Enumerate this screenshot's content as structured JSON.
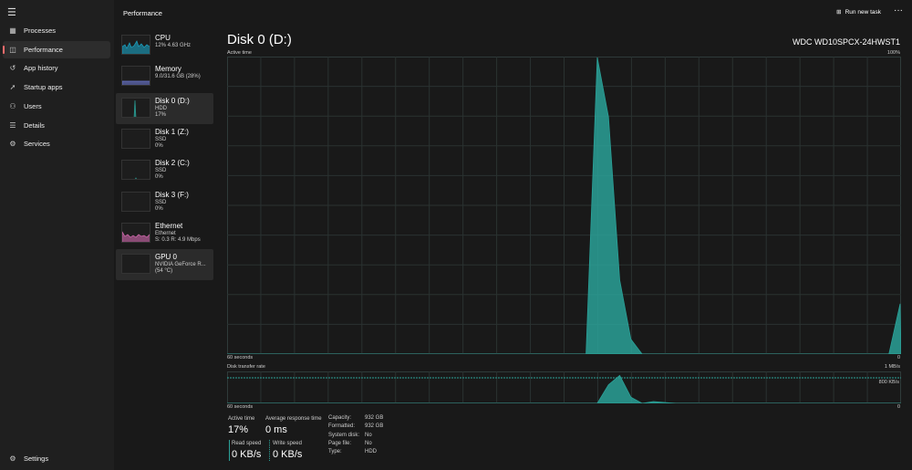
{
  "nav": {
    "items": [
      {
        "label": "Processes",
        "icon": "grid-icon"
      },
      {
        "label": "Performance",
        "icon": "chart-icon"
      },
      {
        "label": "App history",
        "icon": "history-icon"
      },
      {
        "label": "Startup apps",
        "icon": "rocket-icon"
      },
      {
        "label": "Users",
        "icon": "users-icon"
      },
      {
        "label": "Details",
        "icon": "list-icon"
      },
      {
        "label": "Services",
        "icon": "gear-icon"
      }
    ],
    "settings": "Settings"
  },
  "header": {
    "title": "Performance",
    "run_new_task": "Run new task",
    "more": "···"
  },
  "devices": [
    {
      "name": "CPU",
      "l1": "12% 4.63 GHz",
      "l2": "",
      "color": "#1aa4c4"
    },
    {
      "name": "Memory",
      "l1": "9.0/31.6 GB (28%)",
      "l2": "",
      "color": "#6c78d0"
    },
    {
      "name": "Disk 0 (D:)",
      "l1": "HDD",
      "l2": "17%",
      "color": "#2aa198"
    },
    {
      "name": "Disk 1 (Z:)",
      "l1": "SSD",
      "l2": "0%",
      "color": "#2aa198"
    },
    {
      "name": "Disk 2 (C:)",
      "l1": "SSD",
      "l2": "0%",
      "color": "#2aa198"
    },
    {
      "name": "Disk 3 (F:)",
      "l1": "SSD",
      "l2": "0%",
      "color": "#2aa198"
    },
    {
      "name": "Ethernet",
      "l1": "Ethernet",
      "l2": "S: 0.3 R: 4.9 Mbps",
      "color": "#d46bb0"
    },
    {
      "name": "GPU 0",
      "l1": "NVIDIA GeForce R...",
      "l2": "(54 °C)",
      "color": "#6c78d0"
    }
  ],
  "detail": {
    "title": "Disk 0 (D:)",
    "model": "WDC WD10SPCX-24HWST1",
    "chart1": {
      "label": "Active time",
      "max": "100%",
      "xleft": "60 seconds",
      "xright": "0"
    },
    "chart2": {
      "label": "Disk transfer rate",
      "max": "1 MB/s",
      "mid": "800 KB/s",
      "xleft": "60 seconds",
      "xright": "0"
    },
    "stats": {
      "active_label": "Active time",
      "active": "17%",
      "resp_label": "Average response time",
      "resp": "0 ms",
      "read_label": "Read speed",
      "read": "0 KB/s",
      "write_label": "Write speed",
      "write": "0 KB/s"
    },
    "props": [
      [
        "Capacity:",
        "932 GB"
      ],
      [
        "Formatted:",
        "932 GB"
      ],
      [
        "System disk:",
        "No"
      ],
      [
        "Page file:",
        "No"
      ],
      [
        "Type:",
        "HDD"
      ]
    ]
  },
  "chart_data": {
    "type": "area",
    "series": [
      {
        "name": "Active time (%)",
        "values": [
          0,
          0,
          0,
          0,
          0,
          0,
          0,
          0,
          0,
          0,
          0,
          0,
          0,
          0,
          0,
          0,
          0,
          0,
          0,
          0,
          0,
          0,
          0,
          0,
          0,
          0,
          0,
          0,
          0,
          0,
          0,
          0,
          0,
          100,
          80,
          25,
          5,
          0,
          0,
          0,
          0,
          0,
          0,
          0,
          0,
          0,
          0,
          0,
          0,
          0,
          0,
          0,
          0,
          0,
          0,
          0,
          0,
          0,
          0,
          0,
          17
        ]
      },
      {
        "name": "Disk transfer rate (fraction of 1 MB/s)",
        "values": [
          0,
          0,
          0,
          0,
          0,
          0,
          0,
          0,
          0,
          0,
          0,
          0,
          0,
          0,
          0,
          0,
          0,
          0,
          0,
          0,
          0,
          0,
          0,
          0,
          0,
          0,
          0,
          0,
          0,
          0,
          0,
          0,
          0,
          0,
          60,
          90,
          20,
          0,
          6,
          3,
          0,
          0,
          0,
          0,
          0,
          0,
          0,
          0,
          0,
          0,
          0,
          0,
          0,
          0,
          0,
          0,
          0,
          0,
          0,
          0,
          0
        ]
      }
    ],
    "accent": "#2aa198"
  }
}
